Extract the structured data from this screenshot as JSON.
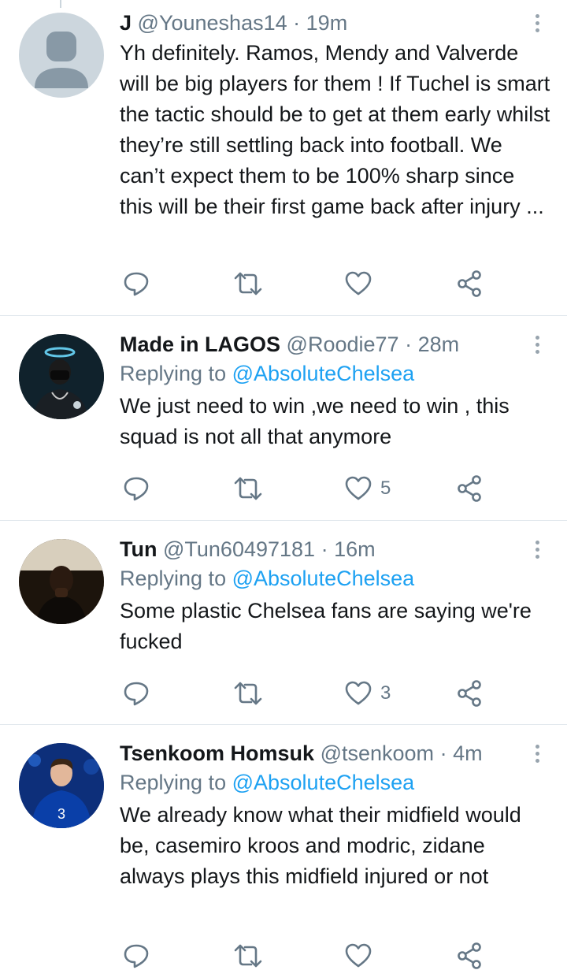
{
  "tweets": [
    {
      "name": "J",
      "handle": "@Youneshas14",
      "separator": "·",
      "time": "19m",
      "reply_prefix": "",
      "reply_to": "",
      "text": "Yh definitely. Ramos, Mendy and Valverde will be big players for them ! If Tuchel is smart the tactic should be to get at them early whilst they’re still settling back into football. We can’t expect them to be 100% sharp since this will be their first game back after injury ...",
      "likes": "",
      "avatar": "default-profile"
    },
    {
      "name": "Made in LAGOS",
      "handle": "@Roodie77",
      "separator": "·",
      "time": "28m",
      "reply_prefix": "Replying to",
      "reply_to": "@AbsoluteChelsea",
      "text": "We just need to win ,we need to win , this squad is not all that anymore",
      "likes": "5",
      "avatar": "masked-figure-halo"
    },
    {
      "name": "Tun",
      "handle": "@Tun60497181",
      "separator": "·",
      "time": "16m",
      "reply_prefix": "Replying to",
      "reply_to": "@AbsoluteChelsea",
      "text": "Some plastic Chelsea fans are saying we're fucked",
      "likes": "3",
      "avatar": "person-photo"
    },
    {
      "name": "Tsenkoom Homsuk",
      "handle": "@tsenkoom",
      "separator": "·",
      "time": "4m",
      "reply_prefix": "Replying to",
      "reply_to": "@AbsoluteChelsea",
      "text": "We already know what their midfield would be, casemiro kroos and modric, zidane always plays this midfield injured or not",
      "likes": "",
      "avatar": "footballer-blue-kit"
    }
  ],
  "icons": {
    "reply": "reply-icon",
    "retweet": "retweet-icon",
    "like": "heart-icon",
    "share": "share-icon",
    "more": "more-options-icon"
  },
  "colors": {
    "link": "#1da1f2",
    "secondary_text": "#657786",
    "divider": "#e1e8ed"
  }
}
